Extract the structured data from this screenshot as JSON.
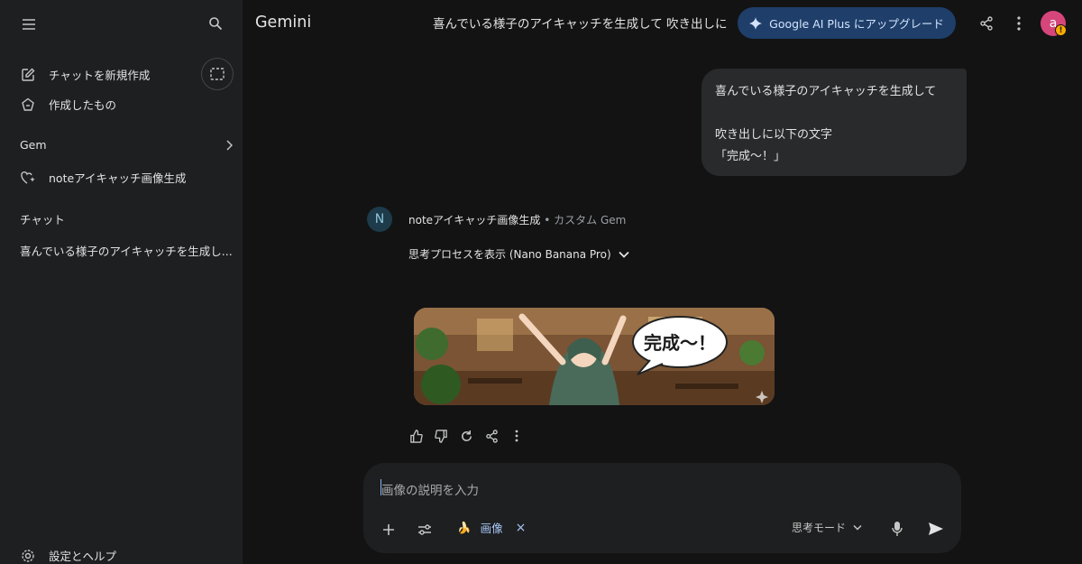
{
  "sidebar": {
    "new_chat": "チャットを新規作成",
    "my_stuff": "作成したもの",
    "gem_heading": "Gem",
    "gem_item": "noteアイキャッチ画像生成",
    "chat_heading": "チャット",
    "recent_chat": "喜んでいる様子のアイキャッチを生成し...",
    "settings": "設定とヘルプ"
  },
  "header": {
    "brand": "Gemini",
    "chat_title": "喜んでいる様子のアイキャッチを生成して 吹き出しに",
    "upgrade_label": "Google AI Plus にアップグレード",
    "avatar_letter": "a",
    "avatar_badge": "!"
  },
  "conversation": {
    "user_message_lines": [
      "喜んでいる様子のアイキャッチを生成して",
      "",
      "吹き出しに以下の文字",
      "「完成〜！」"
    ],
    "gem_avatar_letter": "N",
    "gem_name": "noteアイキャッチ画像生成",
    "gem_subtitle": " • カスタム Gem",
    "thinking_label": "思考プロセスを表示 (Nano Banana Pro)",
    "image_speech_text": "完成〜！"
  },
  "composer": {
    "placeholder": "画像の説明を入力",
    "chip_emoji": "🍌",
    "chip_label": "画像",
    "chip_close": "×",
    "mode_label": "思考モード"
  },
  "colors": {
    "background": "#131314",
    "sidebar": "#1e1f20",
    "upgrade_bg": "#1f3f6a",
    "accent": "#a8c7fa",
    "avatar": "#d6467b"
  }
}
